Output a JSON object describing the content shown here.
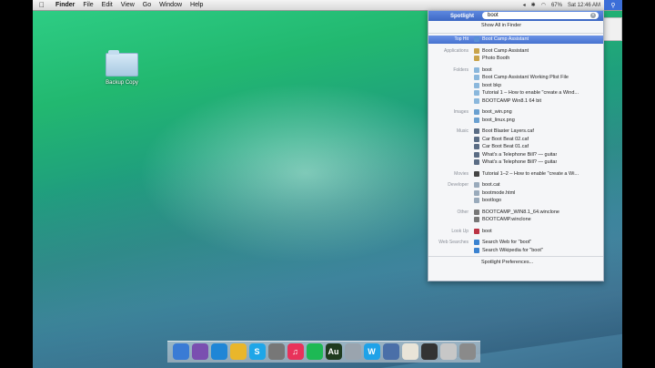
{
  "menubar": {
    "apple": "",
    "items": [
      "Finder",
      "File",
      "Edit",
      "View",
      "Go",
      "Window",
      "Help"
    ],
    "status": [
      "◂",
      "✱",
      "◠",
      "67%",
      "Sat 12:46 AM"
    ]
  },
  "desktop": {
    "folder_label": "Backup Copy"
  },
  "spotlight": {
    "title": "Spotlight",
    "query": "boot",
    "show_all": "Show All in Finder",
    "sections": [
      {
        "category": "Top Hit",
        "items": [
          "Boot Camp Assistant"
        ],
        "selected": 0
      },
      {
        "category": "Applications",
        "items": [
          "Boot Camp Assistant",
          "Photo Booth"
        ]
      },
      {
        "category": "Folders",
        "items": [
          "boot",
          "Boot Camp Assistant Working Plist File",
          "boot bkp",
          "Tutorial 1 – How to enable \"create a Wind...",
          "BOOTCAMP Win8.1 64 bit"
        ]
      },
      {
        "category": "Images",
        "items": [
          "boot_win.png",
          "boot_linux.png"
        ]
      },
      {
        "category": "Music",
        "items": [
          "Boot Blaster Layers.caf",
          "Car Boot Beat 02.caf",
          "Car Boot Beat 01.caf",
          "What's a Telephone Bill? — guitar",
          "What's a Telephone Bill? — guitar"
        ]
      },
      {
        "category": "Movies",
        "items": [
          "Tutorial 1–2 – How to enable \"create a Wi..."
        ]
      },
      {
        "category": "Developer",
        "items": [
          "boot.cat",
          "bootmode.html",
          "bootlogo"
        ]
      },
      {
        "category": "Other",
        "items": [
          "BOOTCAMP_WIN8.1_64.winclone",
          "BOOTCAMP.winclone"
        ]
      },
      {
        "category": "Look Up",
        "items": [
          "boot"
        ]
      },
      {
        "category": "Web Searches",
        "items": [
          "Search Web for \"boot\"",
          "Search Wikipedia for \"boot\""
        ]
      }
    ],
    "preferences": "Spotlight Preferences..."
  },
  "dock": {
    "apps": [
      "finder-icon",
      "launchpad-icon",
      "safari-icon",
      "chrome-icon",
      "skype-icon",
      "camera-icon",
      "itunes-icon",
      "spotify-icon",
      "audition-icon",
      "photoshop-icon",
      "word-icon",
      "preview-icon",
      "notes-icon",
      "terminal-icon",
      "downloads-icon",
      "trash-icon"
    ],
    "labels": [
      "",
      "",
      "",
      "",
      "S",
      "",
      "♫",
      "",
      "Au",
      "",
      "W",
      "",
      "",
      "",
      "",
      ""
    ],
    "colors": [
      "#3a7bd5",
      "#7a4fb0",
      "#1f86d6",
      "#e9b62b",
      "#1ea6e8",
      "#777777",
      "#e8325a",
      "#1db954",
      "#1f3b1f",
      "#9aa4ae",
      "#1fa2e8",
      "#4a6fa8",
      "#e9e4d8",
      "#333333",
      "#c7c7c7",
      "#8a8a8a"
    ]
  }
}
